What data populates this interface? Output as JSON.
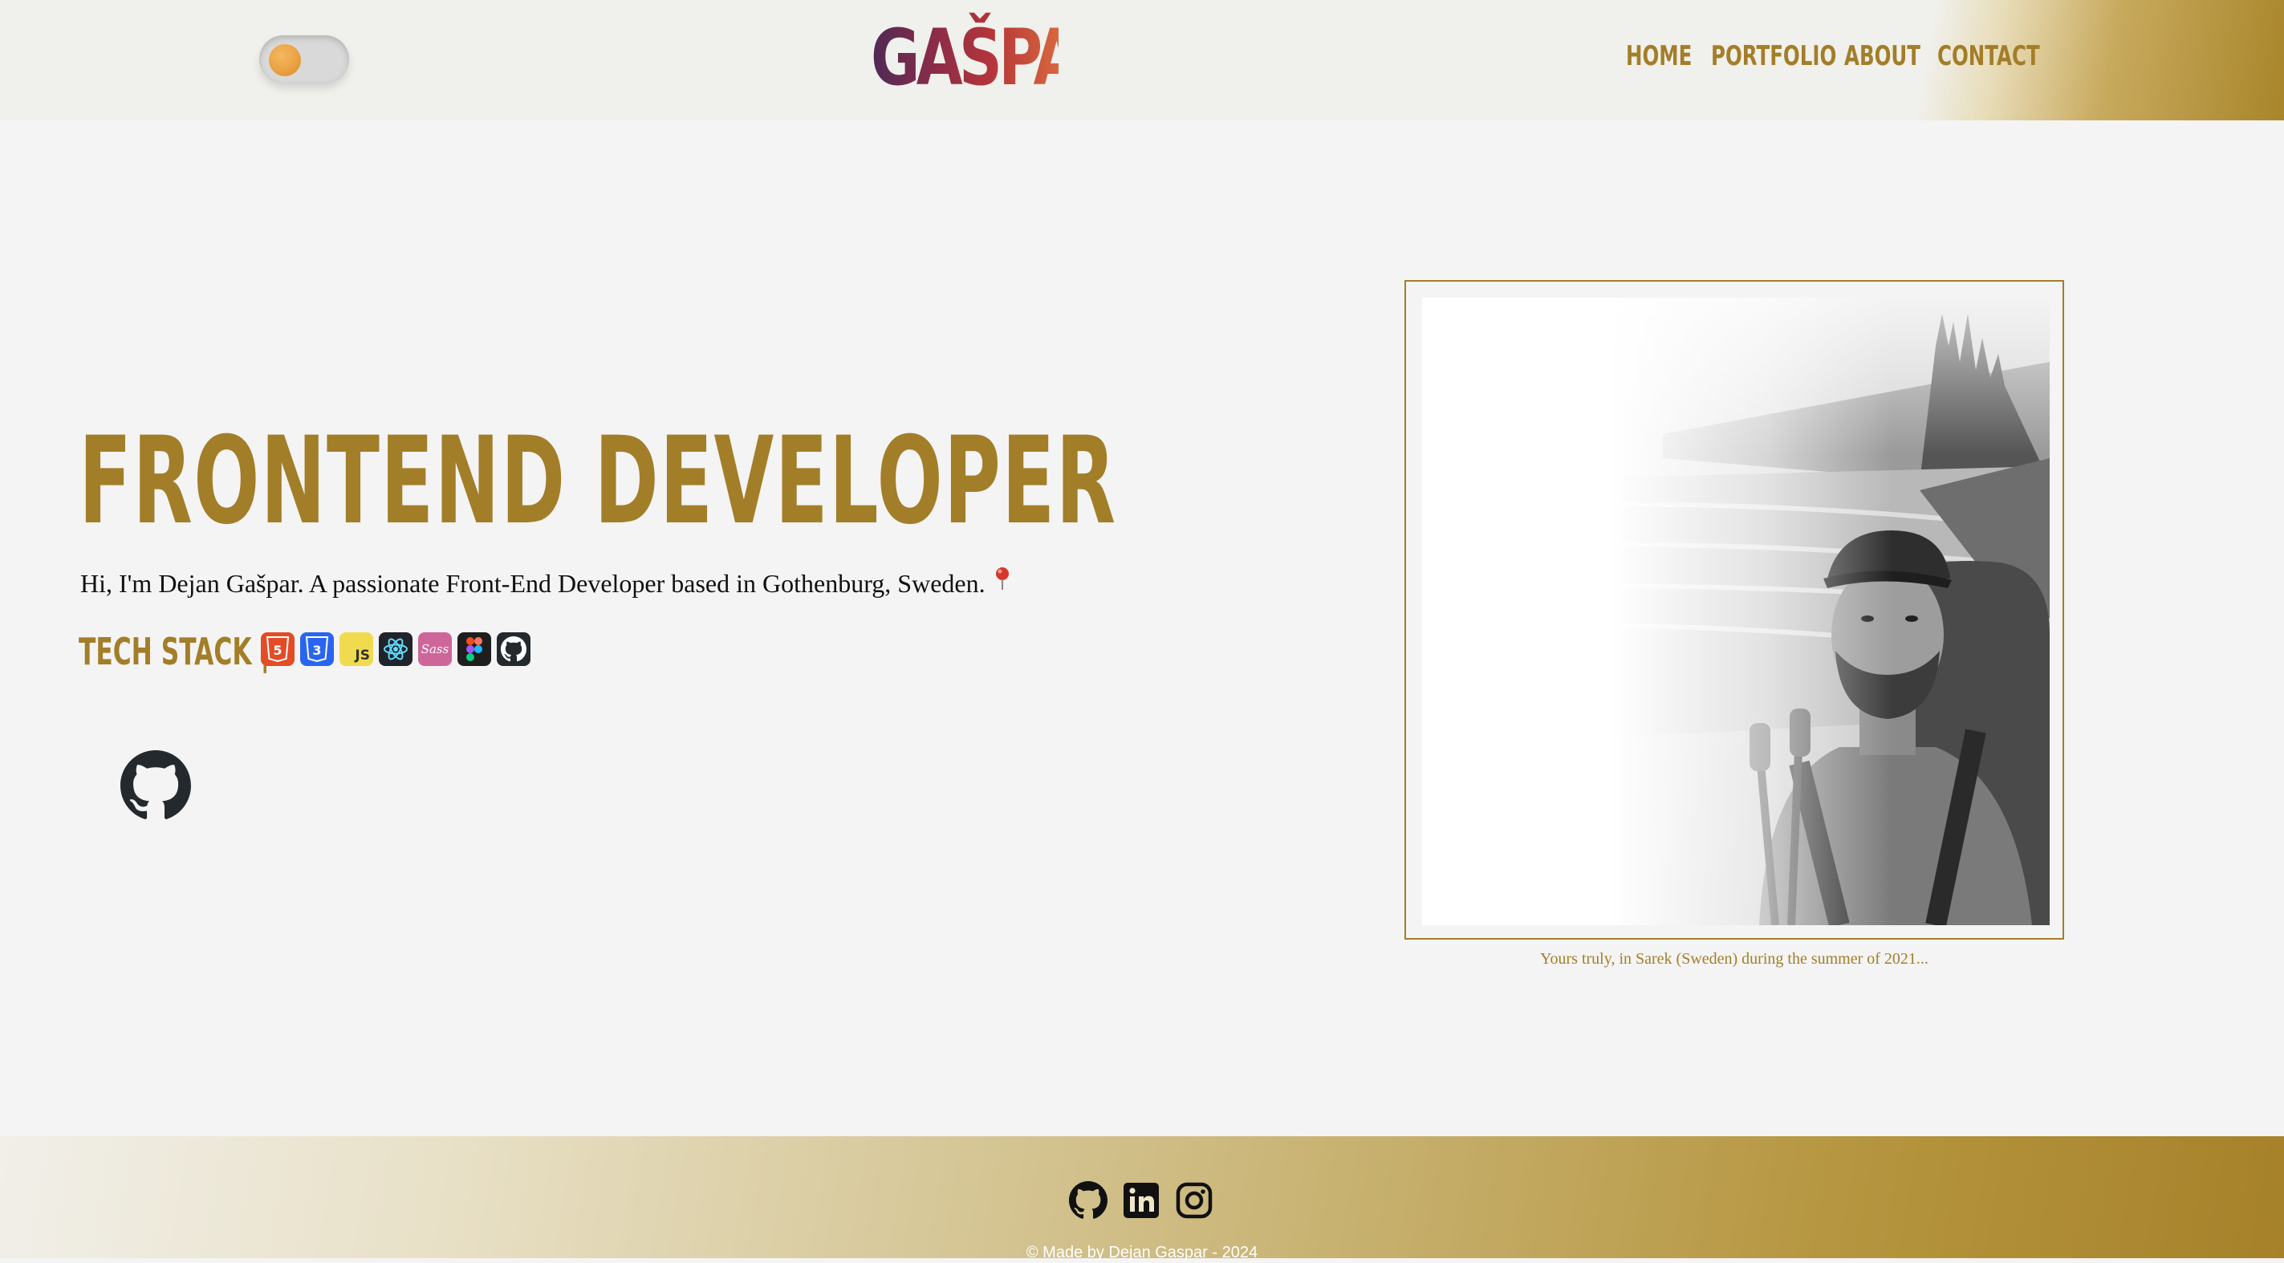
{
  "header": {
    "logo": "GAŠPAR.",
    "theme_toggle": "theme-toggle"
  },
  "nav": {
    "items": [
      {
        "label": "HOME"
      },
      {
        "label": "PORTFOLIO"
      },
      {
        "label": "ABOUT"
      },
      {
        "label": "CONTACT"
      }
    ]
  },
  "hero": {
    "title": "FRONTEND DEVELOPER",
    "intro": "Hi, I'm Dejan Gašpar. A passionate Front-End Developer based in Gothenburg, Sweden.",
    "pin_icon": "pin-icon",
    "tech_stack_label": "TECH STACK  |",
    "tech_icons": [
      {
        "name": "html5-icon",
        "glyph": "5",
        "color": "#e34c26"
      },
      {
        "name": "css3-icon",
        "glyph": "3",
        "color": "#2965f1"
      },
      {
        "name": "javascript-icon",
        "glyph": "JS",
        "color": "#f0db4f"
      },
      {
        "name": "react-icon",
        "glyph": "⚛",
        "color": "#20232a"
      },
      {
        "name": "sass-icon",
        "glyph": "Sass",
        "color": "#cd6799"
      },
      {
        "name": "figma-icon",
        "glyph": "F",
        "color": "#1e1e1e"
      },
      {
        "name": "github-icon",
        "glyph": "GH",
        "color": "#24292e"
      }
    ],
    "github_link_icon": "github-icon"
  },
  "photo": {
    "caption": "Yours truly, in Sarek (Sweden) during the summer of 2021..."
  },
  "footer": {
    "icons": [
      "github-icon",
      "linkedin-icon",
      "instagram-icon"
    ],
    "copyright": "© Made by Dejan Gaspar - 2024"
  },
  "colors": {
    "accent": "#a37e28",
    "toggle_knob": "#e9a040"
  }
}
